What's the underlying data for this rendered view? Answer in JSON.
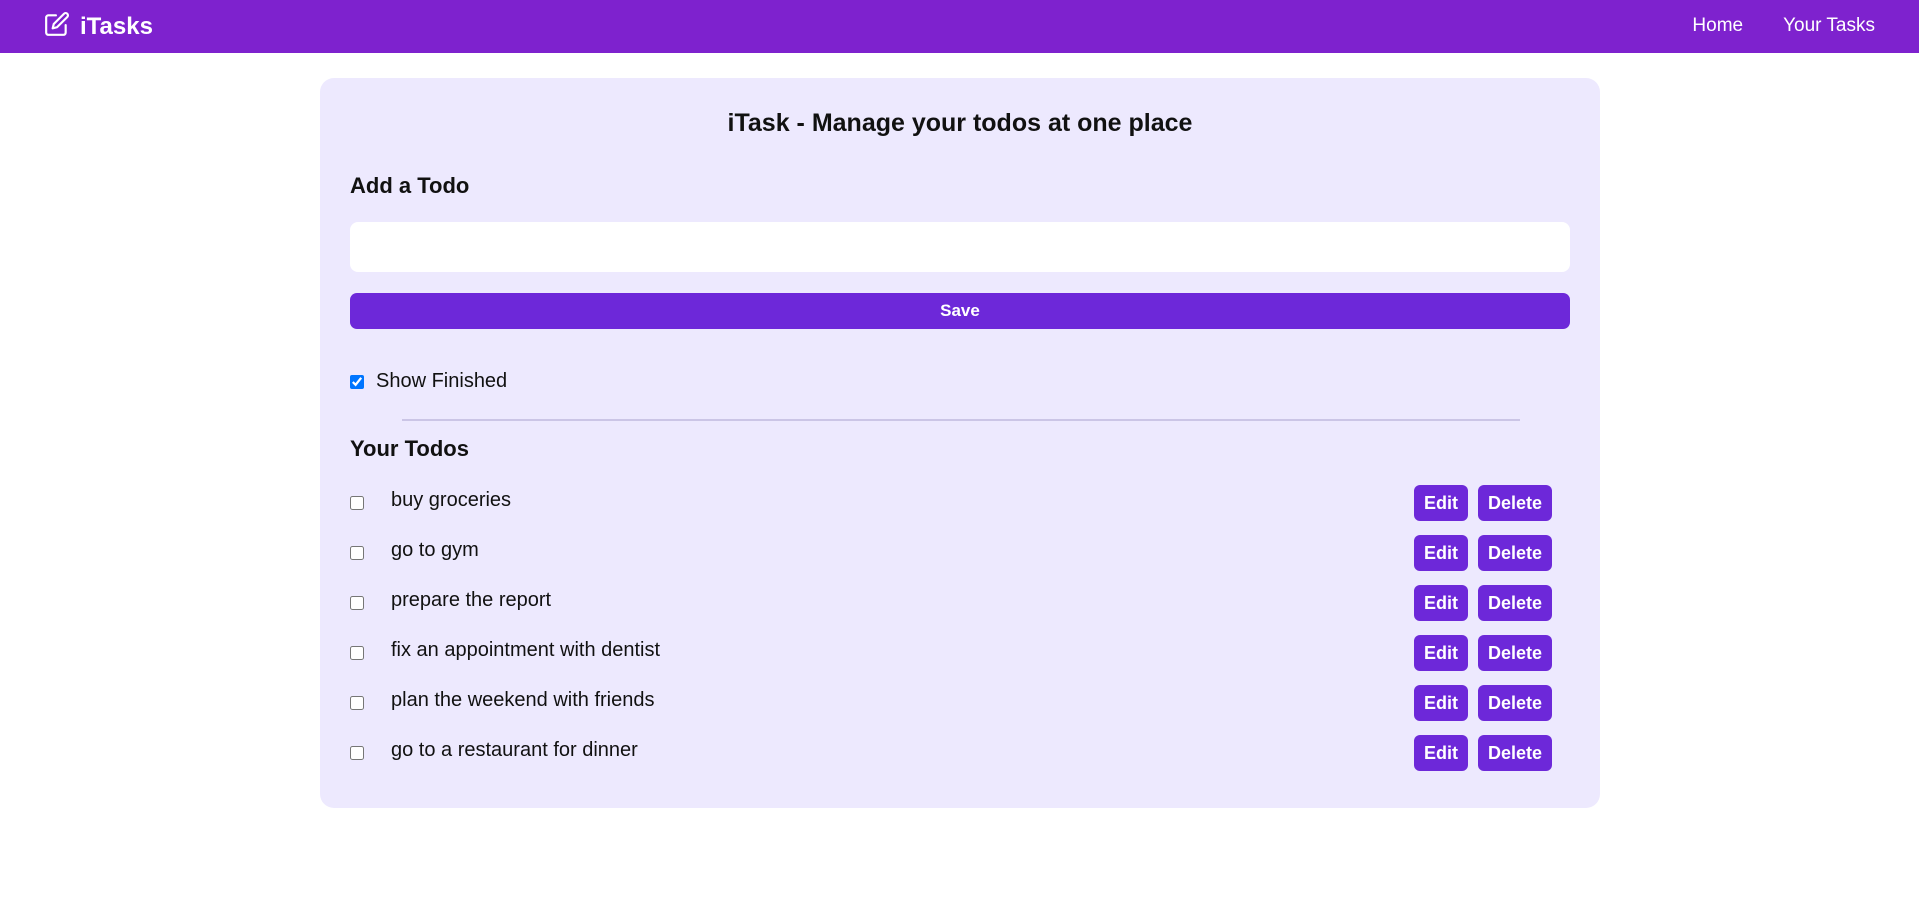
{
  "navbar": {
    "brand": "iTasks",
    "brand_icon": "edit-icon",
    "links": [
      "Home",
      "Your Tasks"
    ],
    "color": "#7e22ce"
  },
  "main": {
    "title": "iTask - Manage your todos at one place",
    "add_heading": "Add a Todo",
    "input_value": "",
    "save_label": "Save",
    "show_finished_label": "Show Finished",
    "show_finished_checked": true,
    "todos_heading": "Your Todos",
    "todos": [
      {
        "text": "buy groceries",
        "done": false
      },
      {
        "text": "go to gym",
        "done": false
      },
      {
        "text": "prepare the report",
        "done": false
      },
      {
        "text": "fix an appointment with dentist",
        "done": false
      },
      {
        "text": "plan the weekend with friends",
        "done": false
      },
      {
        "text": "go to a restaurant for dinner",
        "done": false
      }
    ],
    "edit_label": "Edit",
    "delete_label": "Delete",
    "panel_color": "#ede9fe",
    "button_color": "#6d28d9"
  }
}
